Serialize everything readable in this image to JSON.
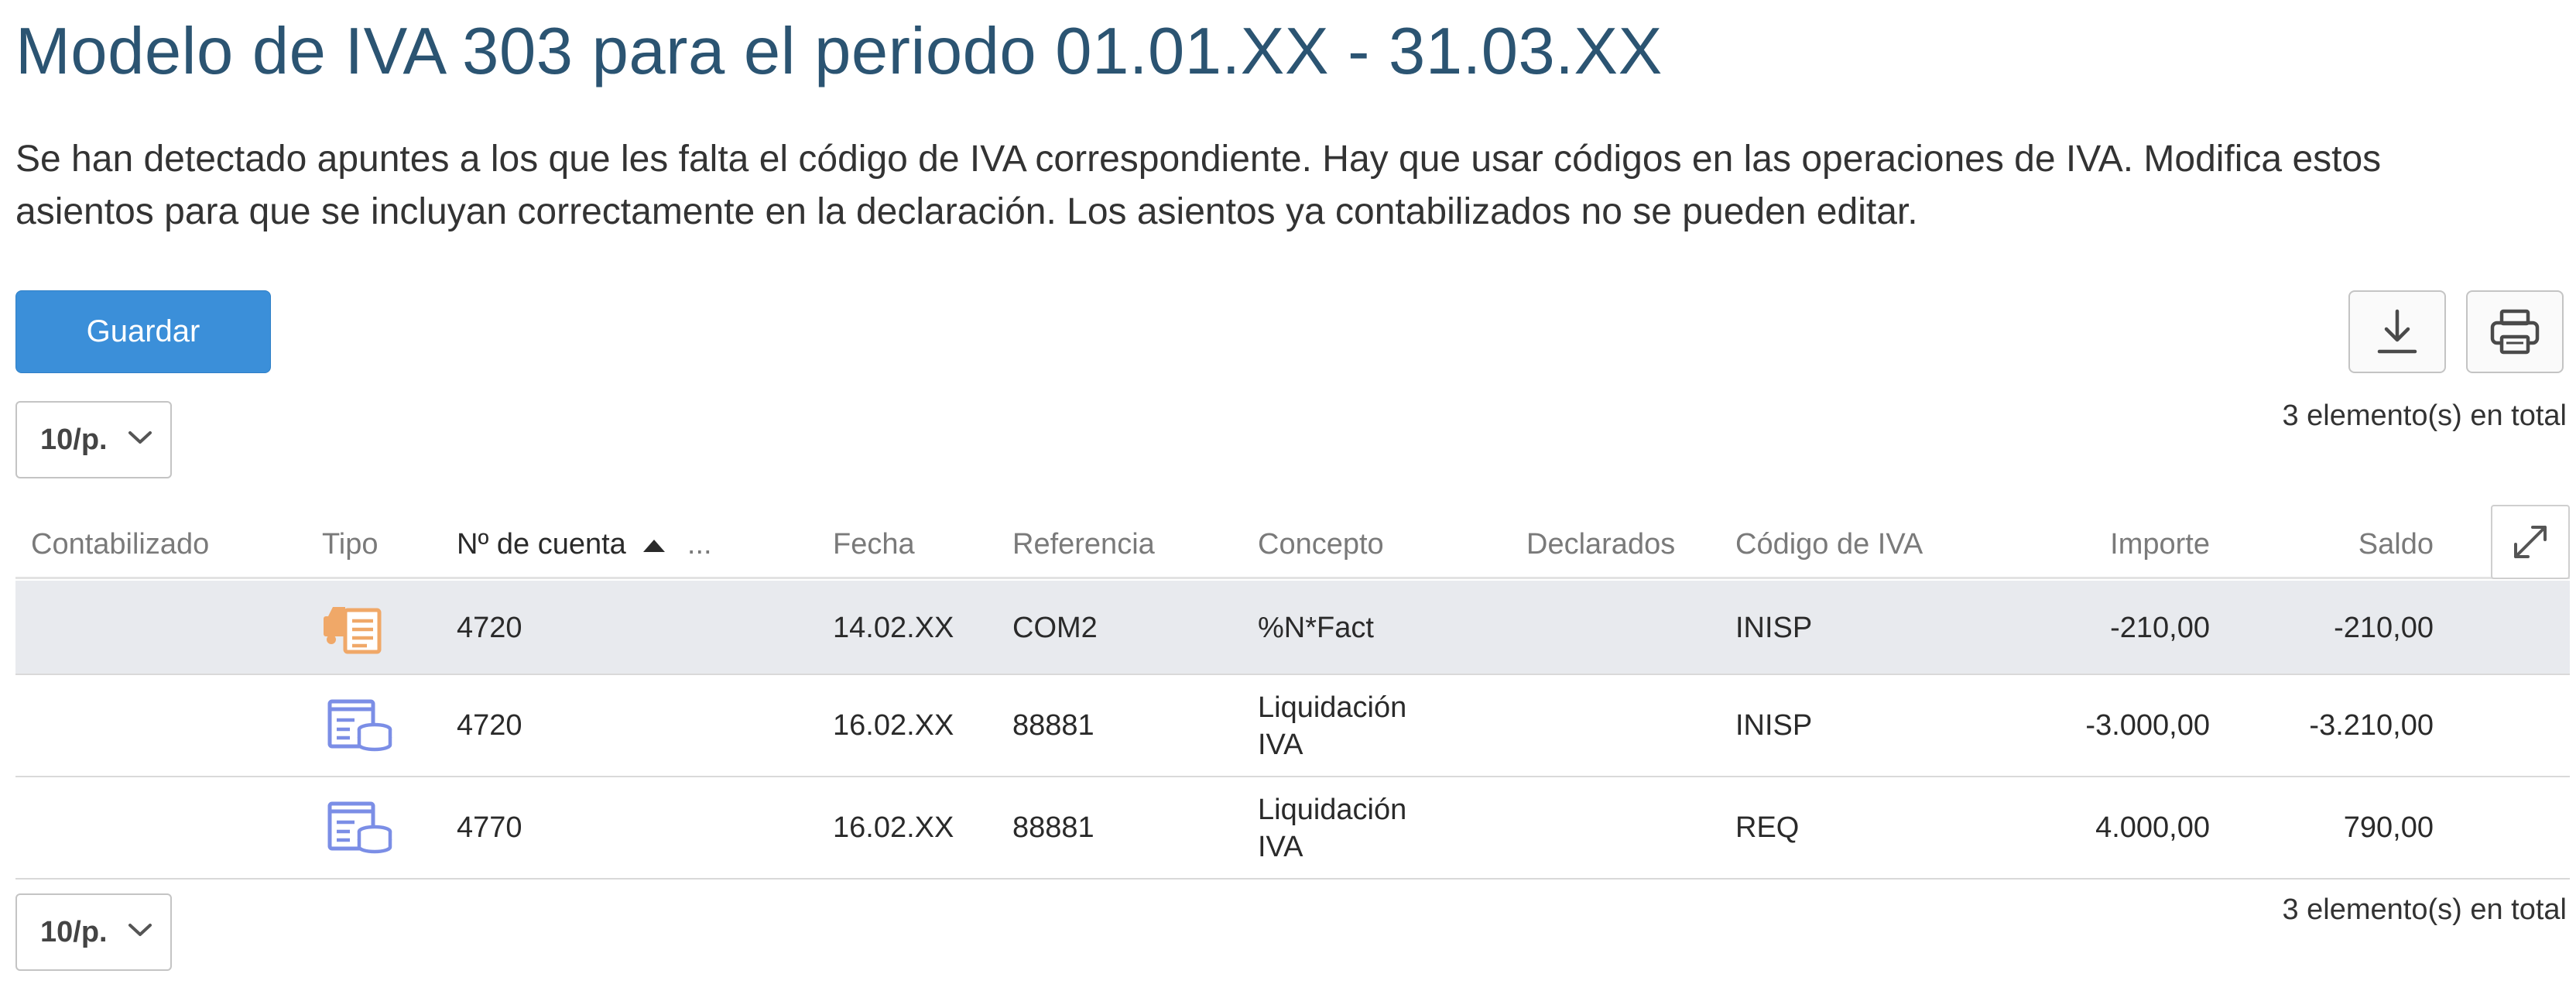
{
  "header": {
    "title": "Modelo de IVA 303 para el periodo 01.01.XX - 31.03.XX",
    "description": "Se han detectado apuntes a los que les falta el código de IVA correspondiente. Hay que usar códigos en las operaciones de IVA. Modifica estos asientos para que se incluyan correctamente en la declaración. Los asientos ya contabilizados no se pueden editar."
  },
  "toolbar": {
    "save_label": "Guardar",
    "download_icon": "download-icon",
    "print_icon": "printer-icon"
  },
  "pagination": {
    "page_size": "10/p.",
    "total_text": "3 elemento(s) en total"
  },
  "table": {
    "columns": {
      "contabilizado": "Contabilizado",
      "tipo": "Tipo",
      "cuenta": "Nº de cuenta",
      "cuenta_more": "...",
      "fecha": "Fecha",
      "referencia": "Referencia",
      "concepto": "Concepto",
      "declarados": "Declarados",
      "codigo_iva": "Código de IVA",
      "importe": "Importe",
      "saldo": "Saldo"
    },
    "sort": {
      "column": "cuenta",
      "direction": "ascending"
    },
    "rows": [
      {
        "contabilizado": "",
        "tipo_icon": "purchase-invoice-icon",
        "cuenta": "4720",
        "fecha": "14.02.XX",
        "referencia": "COM2",
        "concepto": "%N*Fact",
        "declarados": "",
        "codigo_iva": "INISP",
        "importe": "-210,00",
        "saldo": "-210,00"
      },
      {
        "contabilizado": "",
        "tipo_icon": "journal-entry-icon",
        "cuenta": "4720",
        "fecha": "16.02.XX",
        "referencia": "88881",
        "concepto": "Liquidación IVA",
        "declarados": "",
        "codigo_iva": "INISP",
        "importe": "-3.000,00",
        "saldo": "-3.210,00"
      },
      {
        "contabilizado": "",
        "tipo_icon": "journal-entry-icon",
        "cuenta": "4770",
        "fecha": "16.02.XX",
        "referencia": "88881",
        "concepto": "Liquidación IVA",
        "declarados": "",
        "codigo_iva": "REQ",
        "importe": "4.000,00",
        "saldo": "790,00"
      }
    ]
  },
  "colors": {
    "title": "#2b5472",
    "primary_button": "#3b8fd9",
    "selected_row": "#e8eaee",
    "purchase_icon": "#f0a868",
    "journal_icon": "#7b8ee6"
  }
}
